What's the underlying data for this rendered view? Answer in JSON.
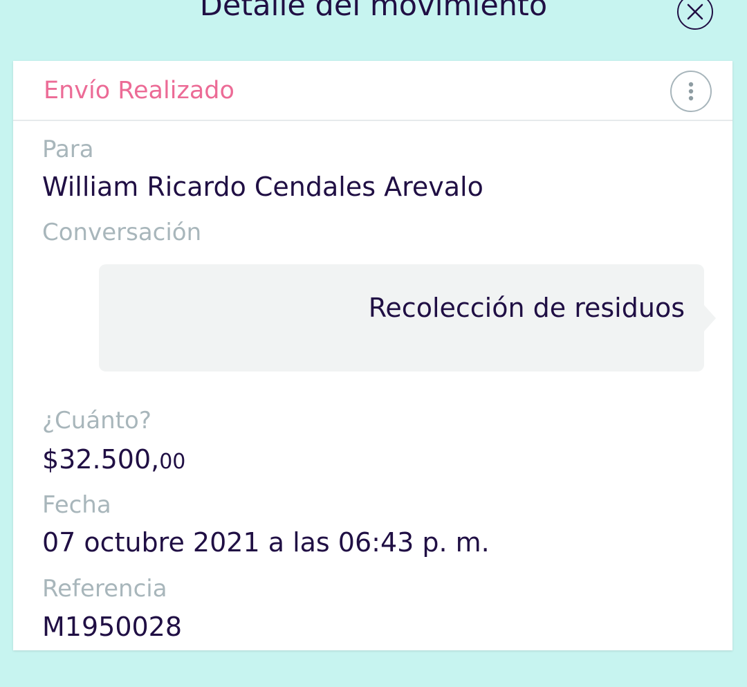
{
  "header": {
    "title": "Detalle del movimiento",
    "close_icon": "close-icon"
  },
  "card": {
    "status": "Envío Realizado",
    "status_color": "#ec6b96",
    "more_icon": "more-vertical-icon",
    "recipient": {
      "label": "Para",
      "value": "William Ricardo Cendales Arevalo"
    },
    "conversation": {
      "label": "Conversación",
      "message": "Recolección de residuos"
    },
    "amount": {
      "label": "¿Cuánto?",
      "main": "$32.500,",
      "cents": "00"
    },
    "date": {
      "label": "Fecha",
      "value": "07 octubre 2021 a las 06:43 p. m."
    },
    "reference": {
      "label": "Referencia",
      "value": "M1950028"
    }
  },
  "colors": {
    "background": "#c7f4f0",
    "primary_text": "#200f44",
    "muted_text": "#a8b6bb",
    "bubble": "#f1f3f3"
  }
}
